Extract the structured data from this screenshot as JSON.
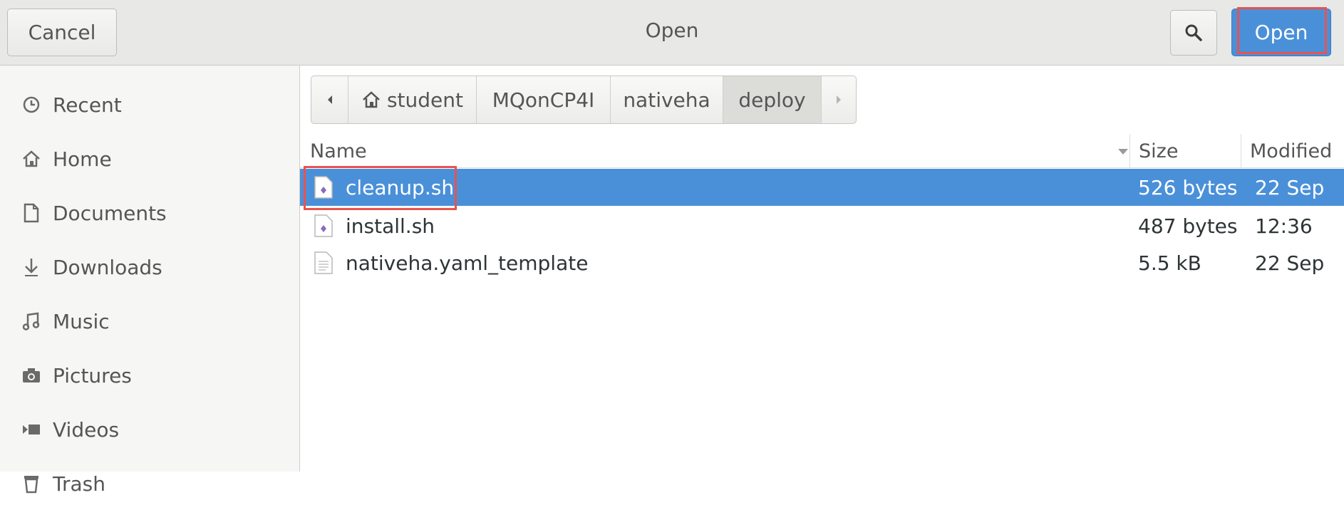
{
  "header": {
    "cancel_label": "Cancel",
    "title": "Open",
    "open_label": "Open",
    "search_icon": "search-icon"
  },
  "sidebar": {
    "items": [
      {
        "label": "Recent",
        "icon": "clock-icon"
      },
      {
        "label": "Home",
        "icon": "home-icon"
      },
      {
        "label": "Documents",
        "icon": "document-icon"
      },
      {
        "label": "Downloads",
        "icon": "download-icon"
      },
      {
        "label": "Music",
        "icon": "music-icon"
      },
      {
        "label": "Pictures",
        "icon": "camera-icon"
      },
      {
        "label": "Videos",
        "icon": "video-icon"
      },
      {
        "label": "Trash",
        "icon": "trash-icon"
      }
    ]
  },
  "pathbar": {
    "segments": [
      "student",
      "MQonCP4I",
      "nativeha",
      "deploy"
    ],
    "active": "deploy"
  },
  "columns": {
    "name": "Name",
    "size": "Size",
    "modified": "Modified"
  },
  "files": [
    {
      "name": "cleanup.sh",
      "size": "526 bytes",
      "modified": "22 Sep",
      "icon": "script-file-icon",
      "selected": true
    },
    {
      "name": "install.sh",
      "size": "487 bytes",
      "modified": "12:36",
      "icon": "script-file-icon",
      "selected": false
    },
    {
      "name": "nativeha.yaml_template",
      "size": "5.5 kB",
      "modified": "22 Sep",
      "icon": "text-file-icon",
      "selected": false
    }
  ],
  "colors": {
    "accent": "#4a90d9",
    "highlight": "#e8534f"
  }
}
